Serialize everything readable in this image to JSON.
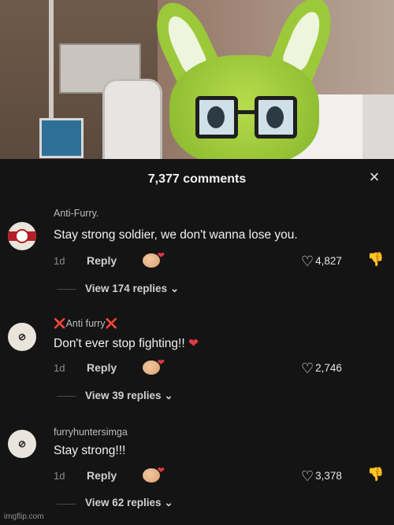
{
  "header": {
    "title": "7,377 comments",
    "close_icon": "×"
  },
  "comments": [
    {
      "username": "Anti-Furry.",
      "text": "Stay strong soldier, we don't wanna lose you.",
      "age": "1d",
      "reply": "Reply",
      "likes": "4,827",
      "view_replies": "View 174 replies"
    },
    {
      "username_prefix": "❌",
      "username": "Anti furry",
      "username_suffix": "❌",
      "text": "Don't ever stop fighting!!",
      "text_heart": "❤",
      "age": "1d",
      "reply": "Reply",
      "likes": "2,746",
      "view_replies": "View 39 replies"
    },
    {
      "username": "furryhuntersimga",
      "text": "Stay strong!!!",
      "age": "1d",
      "reply": "Reply",
      "likes": "3,378",
      "view_replies": "View 62 replies"
    }
  ],
  "chevron": "⌄",
  "watermark": "imgflip.com",
  "colors": {
    "background": "#141414",
    "accent_red": "#e23744"
  }
}
